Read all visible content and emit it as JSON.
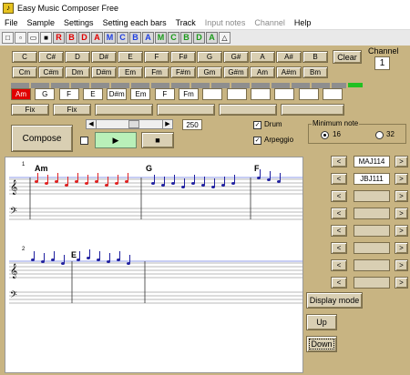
{
  "app": {
    "title": "Easy Music Composer Free"
  },
  "menu": [
    "File",
    "Sample",
    "Settings",
    "Setting each bars",
    "Track",
    "Input notes",
    "Channel",
    "Help"
  ],
  "toolbar": {
    "file_icons": [
      "new-icon",
      "new-icon",
      "open-icon",
      "save-icon"
    ],
    "letters": [
      {
        "t": "R",
        "c": "#e00000"
      },
      {
        "t": "B",
        "c": "#e00000"
      },
      {
        "t": "D",
        "c": "#e00000"
      },
      {
        "t": "A",
        "c": "#e00000"
      },
      {
        "t": "M",
        "c": "#2040e0"
      },
      {
        "t": "C",
        "c": "#2040e0"
      },
      {
        "t": "B",
        "c": "#2040e0"
      },
      {
        "t": "A",
        "c": "#2040e0"
      },
      {
        "t": "M",
        "c": "#1a9a1a"
      },
      {
        "t": "C",
        "c": "#1a9a1a"
      },
      {
        "t": "B",
        "c": "#1a9a1a"
      },
      {
        "t": "D",
        "c": "#1a9a1a"
      },
      {
        "t": "A",
        "c": "#1a9a1a"
      }
    ]
  },
  "chords_row1": [
    "C",
    "C#",
    "D",
    "D#",
    "E",
    "F",
    "F#",
    "G",
    "G#",
    "A",
    "A#",
    "B"
  ],
  "chords_row2": [
    "Cm",
    "C#m",
    "Dm",
    "D#m",
    "Em",
    "Fm",
    "F#m",
    "Gm",
    "G#m",
    "Am",
    "A#m",
    "Bm"
  ],
  "clear_label": "Clear",
  "channel": {
    "label": "Channel",
    "value": "1"
  },
  "chord_slots": [
    "Am",
    "G",
    "F",
    "E",
    "D#m",
    "Em",
    "F",
    "Fm",
    "",
    "",
    "",
    "",
    "",
    ""
  ],
  "fix_labels": [
    "Fix",
    "Fix"
  ],
  "slider_value": "250",
  "compose_label": "Compose",
  "drum_label": "Drum",
  "arpeggio_label": "Arpeggio",
  "minimum_note": {
    "label": "Minimum note",
    "options": [
      "16",
      "32"
    ],
    "selected": "16"
  },
  "tracks": [
    {
      "name": "MAJ114"
    },
    {
      "name": "JBJ111"
    },
    {
      "name": ""
    },
    {
      "name": ""
    },
    {
      "name": ""
    },
    {
      "name": ""
    },
    {
      "name": ""
    },
    {
      "name": ""
    }
  ],
  "nav": {
    "left": "<",
    "right": ">"
  },
  "display_mode_label": "Display mode",
  "up_label": "Up",
  "down_label": "Down",
  "score": {
    "line1_chords": [
      "Am",
      "G",
      "F"
    ],
    "line2_number": "2",
    "line2_chord": "E",
    "measure_number": "1"
  }
}
